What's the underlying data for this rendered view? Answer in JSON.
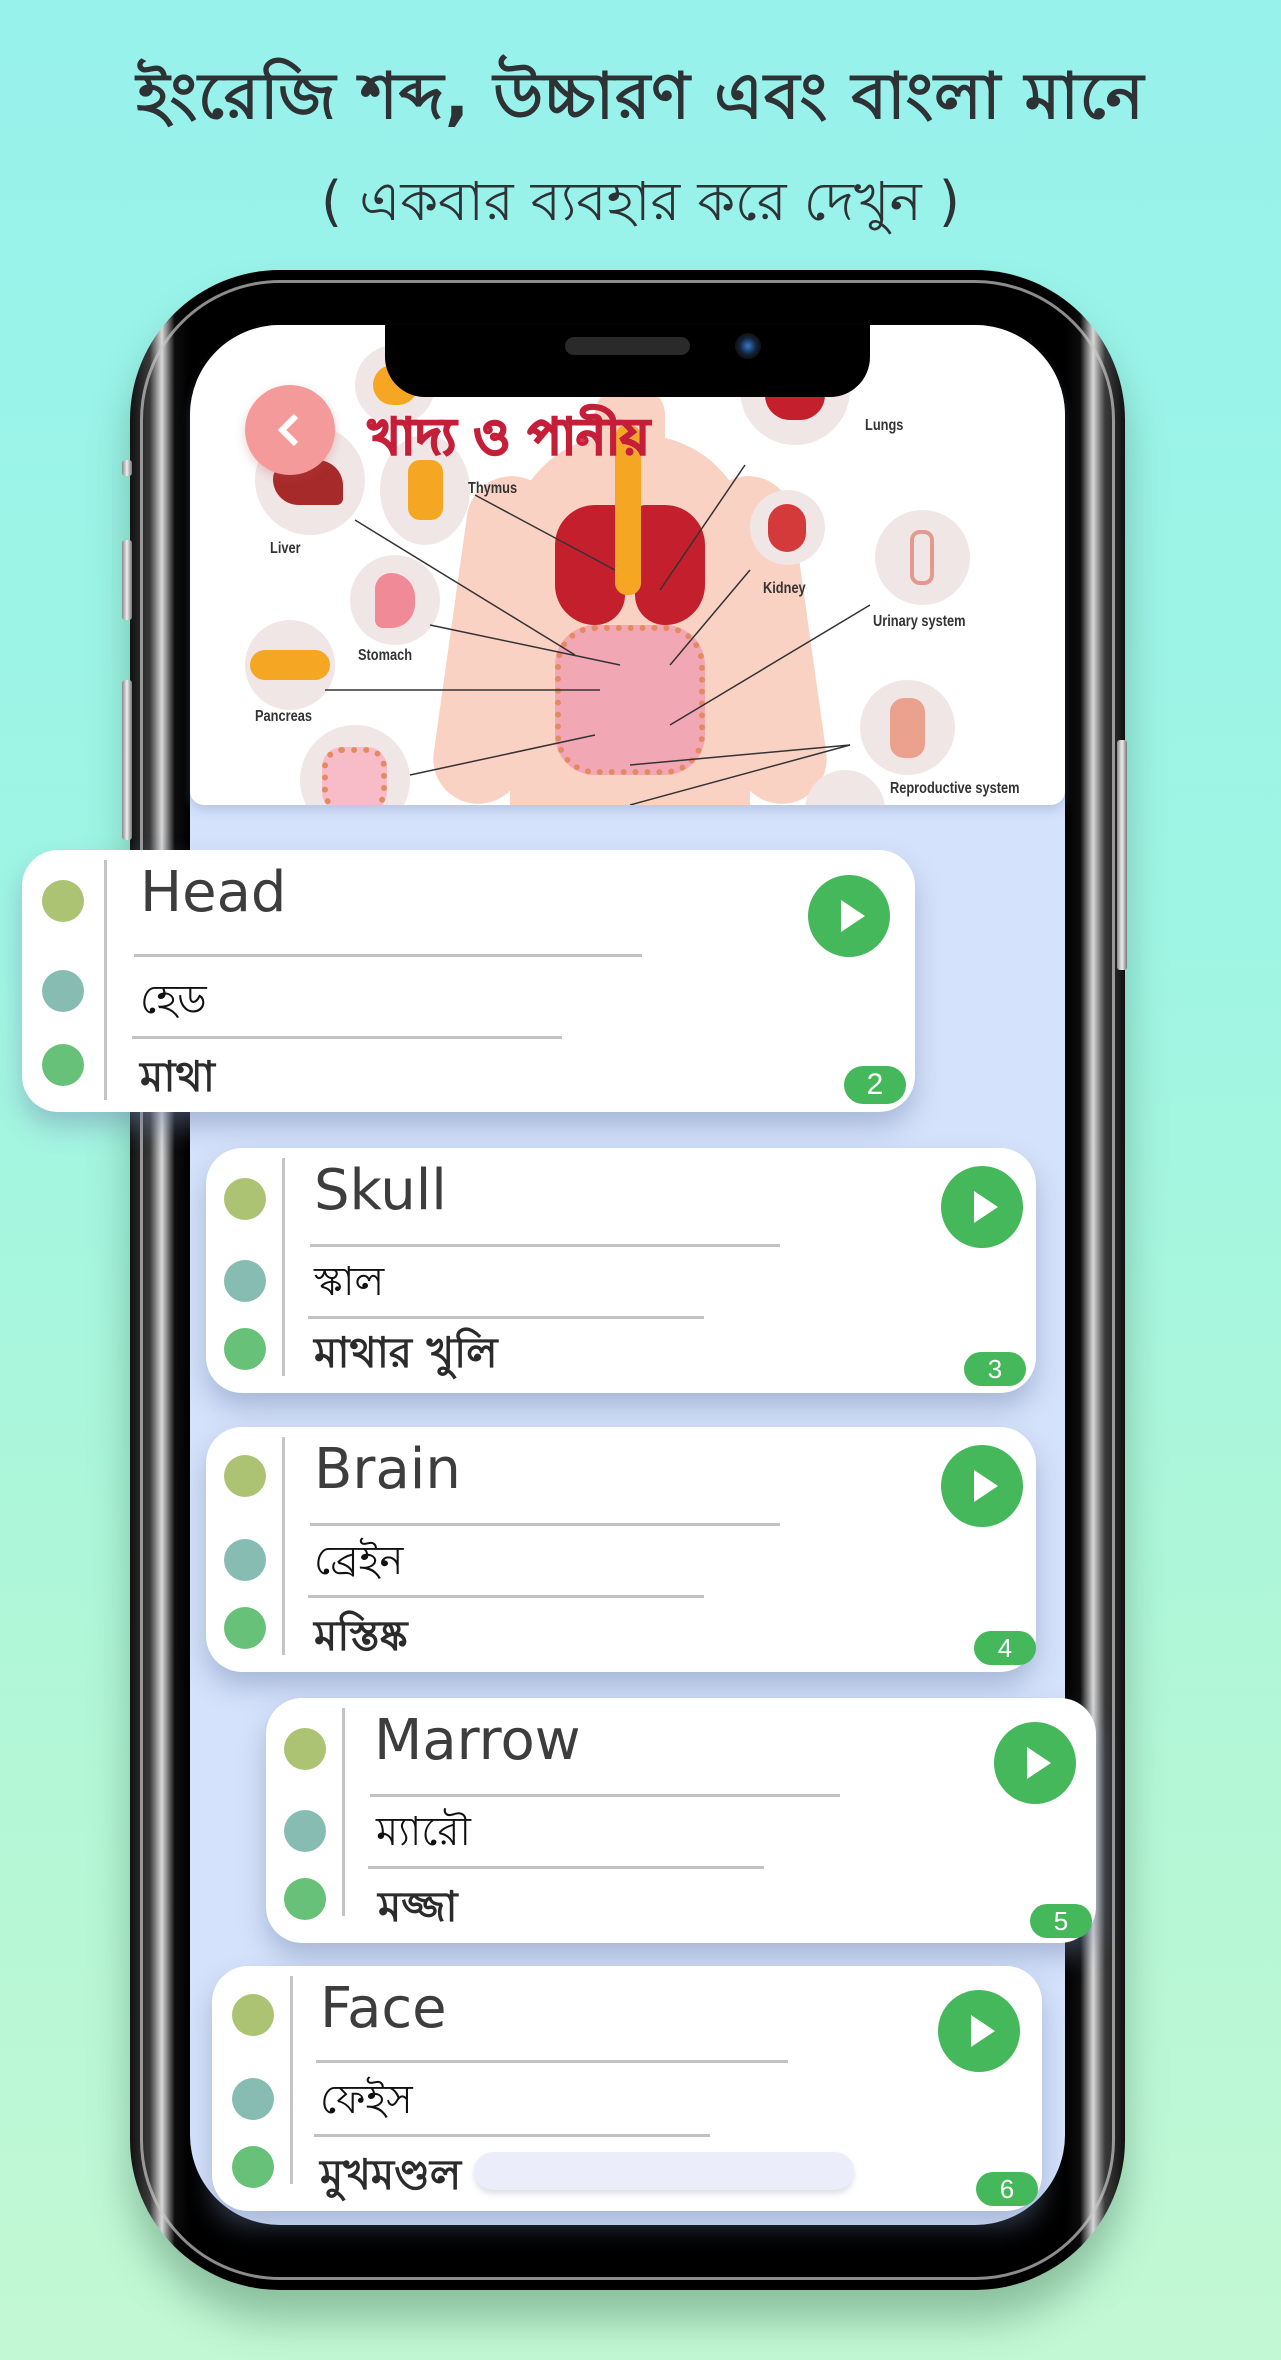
{
  "promo": {
    "headline": "ইংরেজি শব্দ, উচ্চারণ এবং বাংলা মানে",
    "subheadline": "( একবার ব্যবহার করে দেখুন )"
  },
  "screen": {
    "category_title": "খাদ্য ও পানীয়",
    "back_icon": "chevron-left-icon",
    "banner_labels": [
      "Liver",
      "Thymus",
      "Lungs",
      "Kidney",
      "Stomach",
      "Pancreas",
      "Urinary system",
      "Reproductive system"
    ]
  },
  "colors": {
    "accent_green": "#44b85a",
    "title_red": "#e8314b",
    "back_button": "#f59a9a",
    "dot_word": "#abc373",
    "dot_pron": "#87bcb2",
    "dot_meaning": "#68c178",
    "screen_bg": "#d5e2fb"
  },
  "words": [
    {
      "english": "Head",
      "pronunciation": "হেড",
      "meaning": "মাথা",
      "number": "2"
    },
    {
      "english": "Skull",
      "pronunciation": "স্কাল",
      "meaning": "মাথার খুলি",
      "number": "3"
    },
    {
      "english": "Brain",
      "pronunciation": "ব্রেইন",
      "meaning": "মস্তিষ্ক",
      "number": "4"
    },
    {
      "english": "Marrow",
      "pronunciation": "ম্যারৌ",
      "meaning": "মজ্জা",
      "number": "5"
    },
    {
      "english": "Face",
      "pronunciation": "ফেইস",
      "meaning": "মুখমণ্ডল",
      "number": "6"
    }
  ]
}
